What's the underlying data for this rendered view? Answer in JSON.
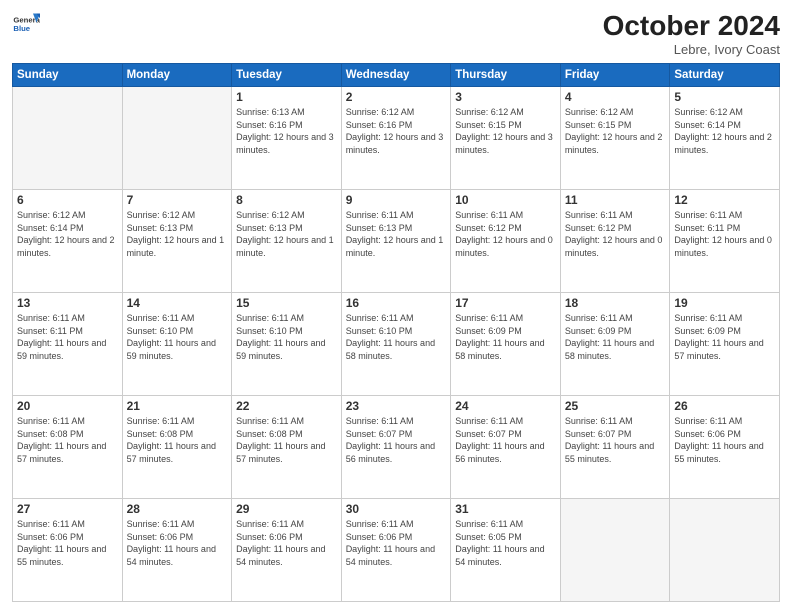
{
  "logo": {
    "line1": "General",
    "line2": "Blue"
  },
  "header": {
    "month": "October 2024",
    "location": "Lebre, Ivory Coast"
  },
  "weekdays": [
    "Sunday",
    "Monday",
    "Tuesday",
    "Wednesday",
    "Thursday",
    "Friday",
    "Saturday"
  ],
  "weeks": [
    [
      {
        "day": "",
        "info": ""
      },
      {
        "day": "",
        "info": ""
      },
      {
        "day": "1",
        "info": "Sunrise: 6:13 AM\nSunset: 6:16 PM\nDaylight: 12 hours and 3 minutes."
      },
      {
        "day": "2",
        "info": "Sunrise: 6:12 AM\nSunset: 6:16 PM\nDaylight: 12 hours and 3 minutes."
      },
      {
        "day": "3",
        "info": "Sunrise: 6:12 AM\nSunset: 6:15 PM\nDaylight: 12 hours and 3 minutes."
      },
      {
        "day": "4",
        "info": "Sunrise: 6:12 AM\nSunset: 6:15 PM\nDaylight: 12 hours and 2 minutes."
      },
      {
        "day": "5",
        "info": "Sunrise: 6:12 AM\nSunset: 6:14 PM\nDaylight: 12 hours and 2 minutes."
      }
    ],
    [
      {
        "day": "6",
        "info": "Sunrise: 6:12 AM\nSunset: 6:14 PM\nDaylight: 12 hours and 2 minutes."
      },
      {
        "day": "7",
        "info": "Sunrise: 6:12 AM\nSunset: 6:13 PM\nDaylight: 12 hours and 1 minute."
      },
      {
        "day": "8",
        "info": "Sunrise: 6:12 AM\nSunset: 6:13 PM\nDaylight: 12 hours and 1 minute."
      },
      {
        "day": "9",
        "info": "Sunrise: 6:11 AM\nSunset: 6:13 PM\nDaylight: 12 hours and 1 minute."
      },
      {
        "day": "10",
        "info": "Sunrise: 6:11 AM\nSunset: 6:12 PM\nDaylight: 12 hours and 0 minutes."
      },
      {
        "day": "11",
        "info": "Sunrise: 6:11 AM\nSunset: 6:12 PM\nDaylight: 12 hours and 0 minutes."
      },
      {
        "day": "12",
        "info": "Sunrise: 6:11 AM\nSunset: 6:11 PM\nDaylight: 12 hours and 0 minutes."
      }
    ],
    [
      {
        "day": "13",
        "info": "Sunrise: 6:11 AM\nSunset: 6:11 PM\nDaylight: 11 hours and 59 minutes."
      },
      {
        "day": "14",
        "info": "Sunrise: 6:11 AM\nSunset: 6:10 PM\nDaylight: 11 hours and 59 minutes."
      },
      {
        "day": "15",
        "info": "Sunrise: 6:11 AM\nSunset: 6:10 PM\nDaylight: 11 hours and 59 minutes."
      },
      {
        "day": "16",
        "info": "Sunrise: 6:11 AM\nSunset: 6:10 PM\nDaylight: 11 hours and 58 minutes."
      },
      {
        "day": "17",
        "info": "Sunrise: 6:11 AM\nSunset: 6:09 PM\nDaylight: 11 hours and 58 minutes."
      },
      {
        "day": "18",
        "info": "Sunrise: 6:11 AM\nSunset: 6:09 PM\nDaylight: 11 hours and 58 minutes."
      },
      {
        "day": "19",
        "info": "Sunrise: 6:11 AM\nSunset: 6:09 PM\nDaylight: 11 hours and 57 minutes."
      }
    ],
    [
      {
        "day": "20",
        "info": "Sunrise: 6:11 AM\nSunset: 6:08 PM\nDaylight: 11 hours and 57 minutes."
      },
      {
        "day": "21",
        "info": "Sunrise: 6:11 AM\nSunset: 6:08 PM\nDaylight: 11 hours and 57 minutes."
      },
      {
        "day": "22",
        "info": "Sunrise: 6:11 AM\nSunset: 6:08 PM\nDaylight: 11 hours and 57 minutes."
      },
      {
        "day": "23",
        "info": "Sunrise: 6:11 AM\nSunset: 6:07 PM\nDaylight: 11 hours and 56 minutes."
      },
      {
        "day": "24",
        "info": "Sunrise: 6:11 AM\nSunset: 6:07 PM\nDaylight: 11 hours and 56 minutes."
      },
      {
        "day": "25",
        "info": "Sunrise: 6:11 AM\nSunset: 6:07 PM\nDaylight: 11 hours and 55 minutes."
      },
      {
        "day": "26",
        "info": "Sunrise: 6:11 AM\nSunset: 6:06 PM\nDaylight: 11 hours and 55 minutes."
      }
    ],
    [
      {
        "day": "27",
        "info": "Sunrise: 6:11 AM\nSunset: 6:06 PM\nDaylight: 11 hours and 55 minutes."
      },
      {
        "day": "28",
        "info": "Sunrise: 6:11 AM\nSunset: 6:06 PM\nDaylight: 11 hours and 54 minutes."
      },
      {
        "day": "29",
        "info": "Sunrise: 6:11 AM\nSunset: 6:06 PM\nDaylight: 11 hours and 54 minutes."
      },
      {
        "day": "30",
        "info": "Sunrise: 6:11 AM\nSunset: 6:06 PM\nDaylight: 11 hours and 54 minutes."
      },
      {
        "day": "31",
        "info": "Sunrise: 6:11 AM\nSunset: 6:05 PM\nDaylight: 11 hours and 54 minutes."
      },
      {
        "day": "",
        "info": ""
      },
      {
        "day": "",
        "info": ""
      }
    ]
  ]
}
